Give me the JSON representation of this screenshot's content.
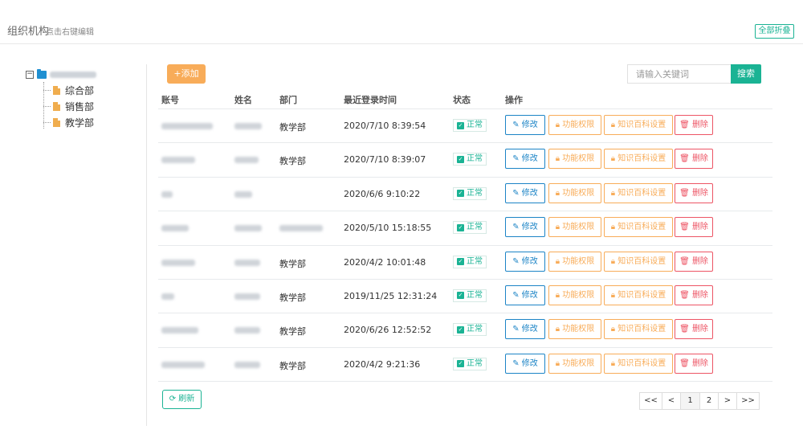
{
  "header": {
    "title": "组织机构",
    "subtitle": "点击右键编辑",
    "collapse_all": "全部折叠"
  },
  "tree": {
    "root_label": "施牙鸟教育",
    "children": [
      {
        "label": "综合部"
      },
      {
        "label": "销售部"
      },
      {
        "label": "教学部"
      }
    ]
  },
  "toolbar": {
    "add_label": "+添加",
    "search_placeholder": "请输入关键词",
    "search_label": "搜索"
  },
  "table": {
    "columns": {
      "account": "账号",
      "name": "姓名",
      "dept": "部门",
      "last_login": "最近登录时间",
      "status": "状态",
      "actions": "操作"
    },
    "actions": {
      "edit": "修改",
      "permission": "功能权限",
      "kb": "知识百科设置",
      "delete": "删除"
    },
    "rows": [
      {
        "account": "guochenpiao",
        "name": "郭晨漂",
        "dept": "教学部",
        "last_login": "2020/7/10 8:39:54",
        "status": "正常"
      },
      {
        "account": "chenying",
        "name": "陈莹",
        "dept": "教学部",
        "last_login": "2020/7/10 8:39:07",
        "status": "正常"
      },
      {
        "account": "vip",
        "name": "VIP",
        "dept": "",
        "last_login": "2020/6/6 9:10:22",
        "status": "正常"
      },
      {
        "account": "jinbidan",
        "name": "金碧丹",
        "dept": "施牙鸟教育",
        "last_login": "2020/5/10 15:18:55",
        "status": "正常"
      },
      {
        "account": "gufengfei",
        "name": "顾风飞",
        "dept": "教学部",
        "last_login": "2020/4/2 10:01:48",
        "status": "正常"
      },
      {
        "account": "lyt",
        "name": "施牙鸟",
        "dept": "教学部",
        "last_login": "2019/11/25 12:31:24",
        "status": "正常"
      },
      {
        "account": "yangmimi",
        "name": "杨秘秘",
        "dept": "教学部",
        "last_login": "2020/6/26 12:52:52",
        "status": "正常"
      },
      {
        "account": "wanglinhua",
        "name": "王林花",
        "dept": "教学部",
        "last_login": "2020/4/2 9:21:36",
        "status": "正常"
      }
    ]
  },
  "refresh_label": "刷新",
  "pager": {
    "first": "<<",
    "prev": "<",
    "pages": [
      "1",
      "2"
    ],
    "current": "1",
    "next": ">",
    "last": ">>"
  }
}
